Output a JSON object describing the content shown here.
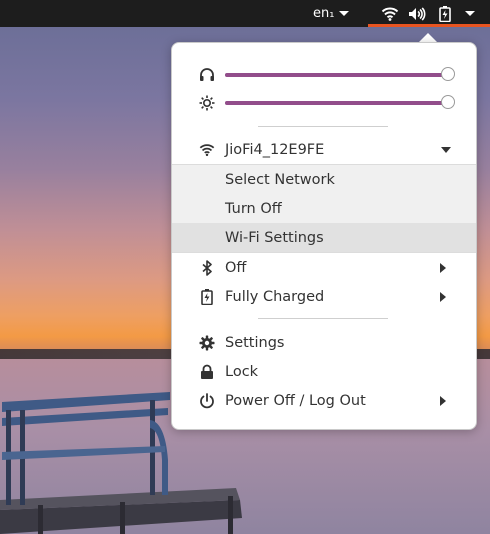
{
  "topbar": {
    "language": "en₁",
    "icons": [
      "wifi-icon",
      "volume-icon",
      "battery-icon",
      "system-menu-arrow"
    ],
    "accent_color": "#e95420"
  },
  "menu": {
    "volume": {
      "icon": "headphones-icon",
      "level": 1.0
    },
    "brightness": {
      "icon": "brightness-icon",
      "level": 1.0
    },
    "wifi": {
      "network": "JioFi4_12E9FE",
      "submenu": [
        "Select Network",
        "Turn Off",
        "Wi-Fi Settings"
      ],
      "highlighted": "Wi-Fi Settings"
    },
    "bluetooth": {
      "label": "Off"
    },
    "power": {
      "label": "Fully Charged"
    },
    "settings": {
      "label": "Settings"
    },
    "lock": {
      "label": "Lock"
    },
    "logout": {
      "label": "Power Off / Log Out"
    },
    "slider_color": "#924d8b"
  }
}
